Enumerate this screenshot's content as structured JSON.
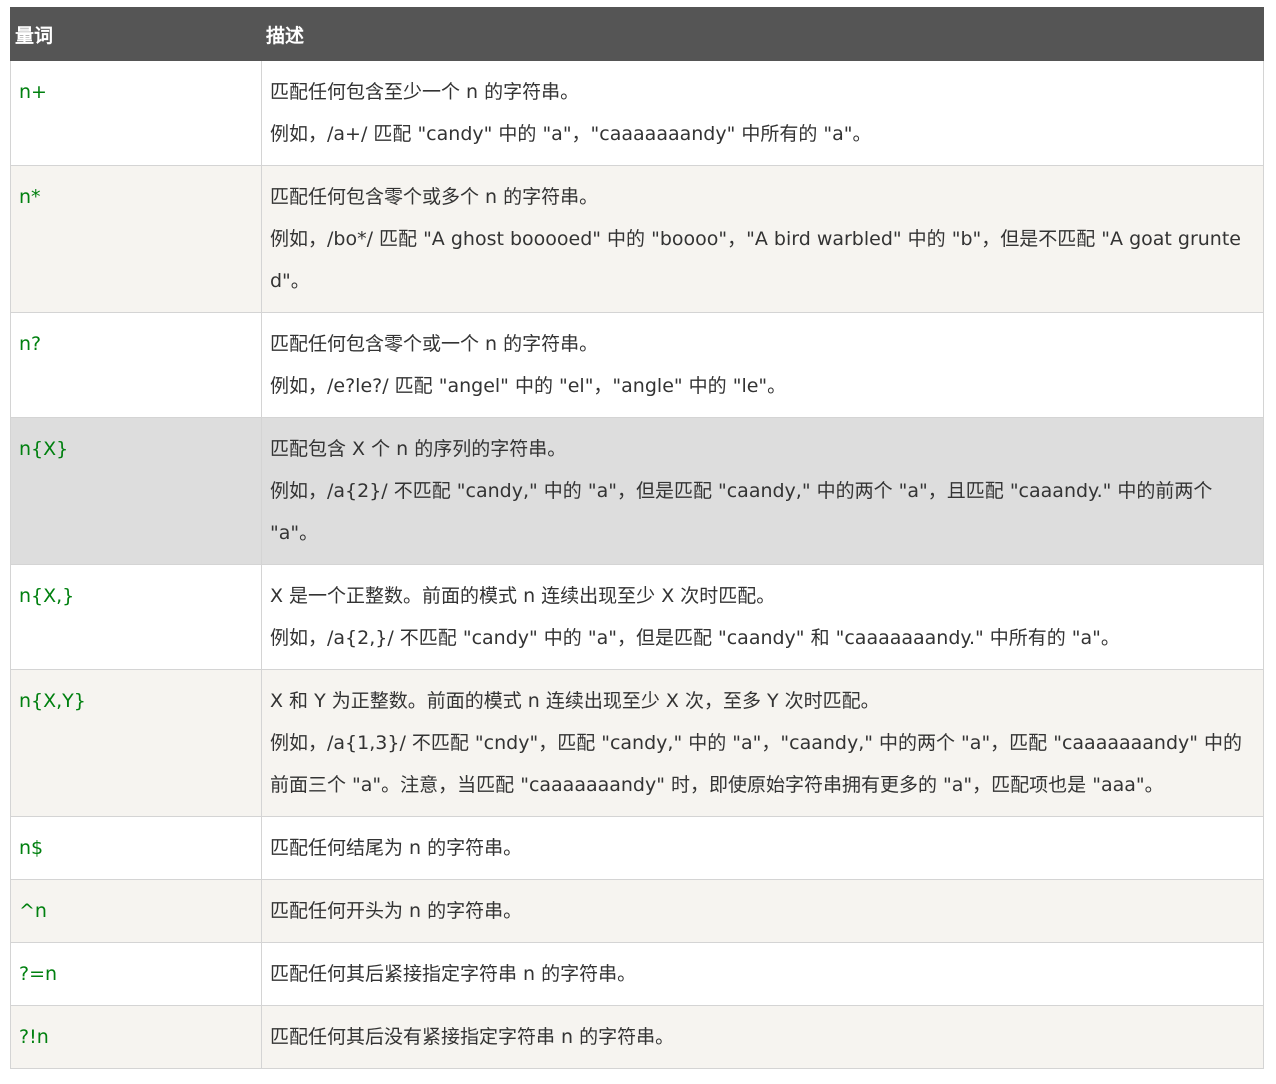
{
  "header": {
    "col_quantifier": "量词",
    "col_description": "描述"
  },
  "rows": [
    {
      "quantifier": "n+",
      "lines": [
        "匹配任何包含至少一个 n 的字符串。",
        "例如，/a+/ 匹配 \"candy\" 中的 \"a\"，\"caaaaaaandy\" 中所有的 \"a\"。"
      ]
    },
    {
      "quantifier": "n*",
      "lines": [
        "匹配任何包含零个或多个 n 的字符串。",
        "例如，/bo*/ 匹配 \"A ghost booooed\" 中的 \"boooo\"，\"A bird warbled\" 中的 \"b\"，但是不匹配 \"A goat grunted\"。"
      ]
    },
    {
      "quantifier": "n?",
      "lines": [
        "匹配任何包含零个或一个 n 的字符串。",
        "例如，/e?le?/ 匹配 \"angel\" 中的 \"el\"，\"angle\" 中的 \"le\"。"
      ]
    },
    {
      "quantifier": "n{X}",
      "lines": [
        "匹配包含 X 个 n 的序列的字符串。",
        "例如，/a{2}/ 不匹配 \"candy,\" 中的 \"a\"，但是匹配 \"caandy,\" 中的两个 \"a\"，且匹配 \"caaandy.\" 中的前两个 \"a\"。"
      ]
    },
    {
      "quantifier": "n{X,}",
      "lines": [
        "X 是一个正整数。前面的模式 n 连续出现至少 X 次时匹配。",
        "例如，/a{2,}/ 不匹配 \"candy\" 中的 \"a\"，但是匹配 \"caandy\" 和 \"caaaaaaandy.\" 中所有的 \"a\"。"
      ]
    },
    {
      "quantifier": "n{X,Y}",
      "lines": [
        "X 和 Y 为正整数。前面的模式 n 连续出现至少 X 次，至多 Y 次时匹配。",
        "例如，/a{1,3}/ 不匹配 \"cndy\"，匹配 \"candy,\" 中的 \"a\"，\"caandy,\" 中的两个 \"a\"，匹配 \"caaaaaaandy\" 中的前面三个 \"a\"。注意，当匹配 \"caaaaaaandy\" 时，即使原始字符串拥有更多的 \"a\"，匹配项也是 \"aaa\"。"
      ]
    },
    {
      "quantifier": "n$",
      "lines": [
        "匹配任何结尾为 n 的字符串。"
      ]
    },
    {
      "quantifier": "^n",
      "lines": [
        "匹配任何开头为 n 的字符串。"
      ]
    },
    {
      "quantifier": "?=n",
      "lines": [
        "匹配任何其后紧接指定字符串 n 的字符串。"
      ]
    },
    {
      "quantifier": "?!n",
      "lines": [
        "匹配任何其后没有紧接指定字符串 n 的字符串。"
      ]
    }
  ],
  "colors": {
    "header_bg": "#555555",
    "quantifier_text": "#00800f",
    "alt_row_bg": "#f6f4f0",
    "hover_row_bg": "#dddddd"
  }
}
